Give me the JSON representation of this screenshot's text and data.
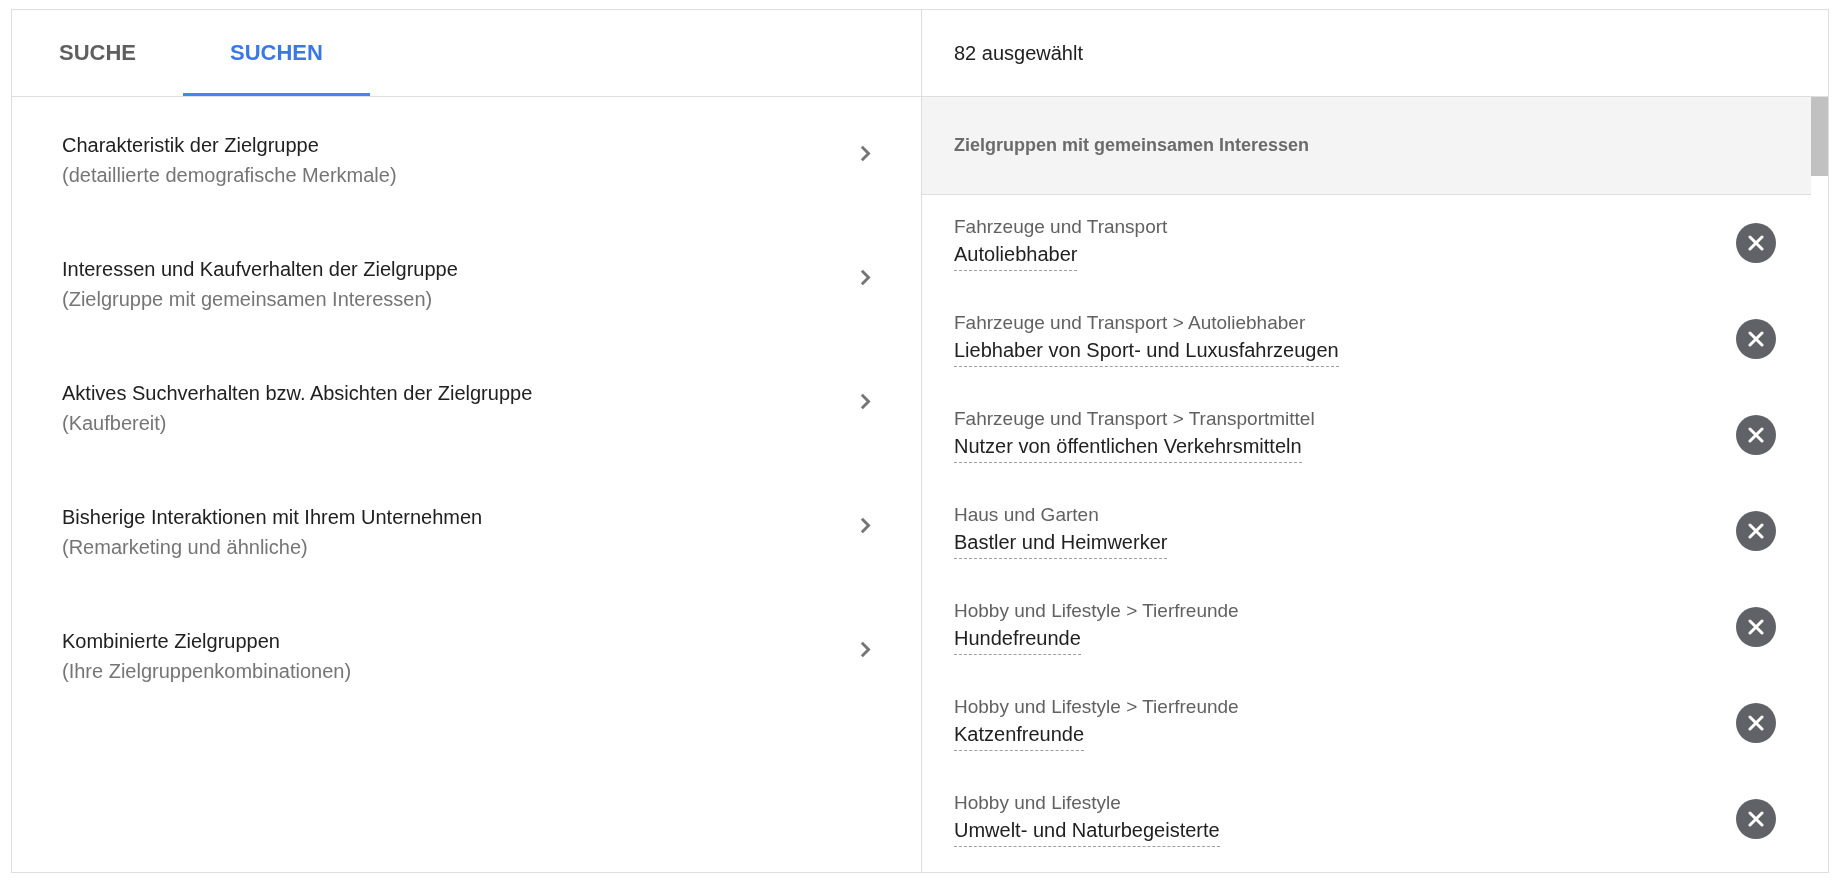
{
  "tabs": [
    {
      "label": "SUCHE",
      "selected": false
    },
    {
      "label": "SUCHEN",
      "selected": true
    }
  ],
  "categories": [
    {
      "title": "Charakteristik der Zielgruppe",
      "subtitle": "(detaillierte demografische Merkmale)"
    },
    {
      "title": "Interessen und Kaufverhalten der Zielgruppe",
      "subtitle": "(Zielgruppe mit gemeinsamen Interessen)"
    },
    {
      "title": "Aktives Suchverhalten bzw. Absichten der Zielgruppe",
      "subtitle": "(Kaufbereit)"
    },
    {
      "title": "Bisherige Interaktionen mit Ihrem Unternehmen",
      "subtitle": "(Remarketing und ähnliche)"
    },
    {
      "title": "Kombinierte Zielgruppen",
      "subtitle": "(Ihre Zielgruppenkombinationen)"
    }
  ],
  "selection": {
    "count_label": "82 ausgewählt",
    "group_header": "Zielgruppen mit gemeinsamen Interessen",
    "items": [
      {
        "path": "Fahrzeuge und Transport",
        "name": "Autoliebhaber"
      },
      {
        "path": "Fahrzeuge und Transport > Autoliebhaber",
        "name": "Liebhaber von Sport- und Luxusfahrzeugen"
      },
      {
        "path": "Fahrzeuge und Transport > Transportmittel",
        "name": "Nutzer von öffentlichen Verkehrsmitteln"
      },
      {
        "path": "Haus und Garten",
        "name": "Bastler und Heimwerker"
      },
      {
        "path": "Hobby und Lifestyle > Tierfreunde",
        "name": "Hundefreunde"
      },
      {
        "path": "Hobby und Lifestyle > Tierfreunde",
        "name": "Katzenfreunde"
      },
      {
        "path": "Hobby und Lifestyle",
        "name": "Umwelt- und Naturbegeisterte"
      }
    ]
  }
}
